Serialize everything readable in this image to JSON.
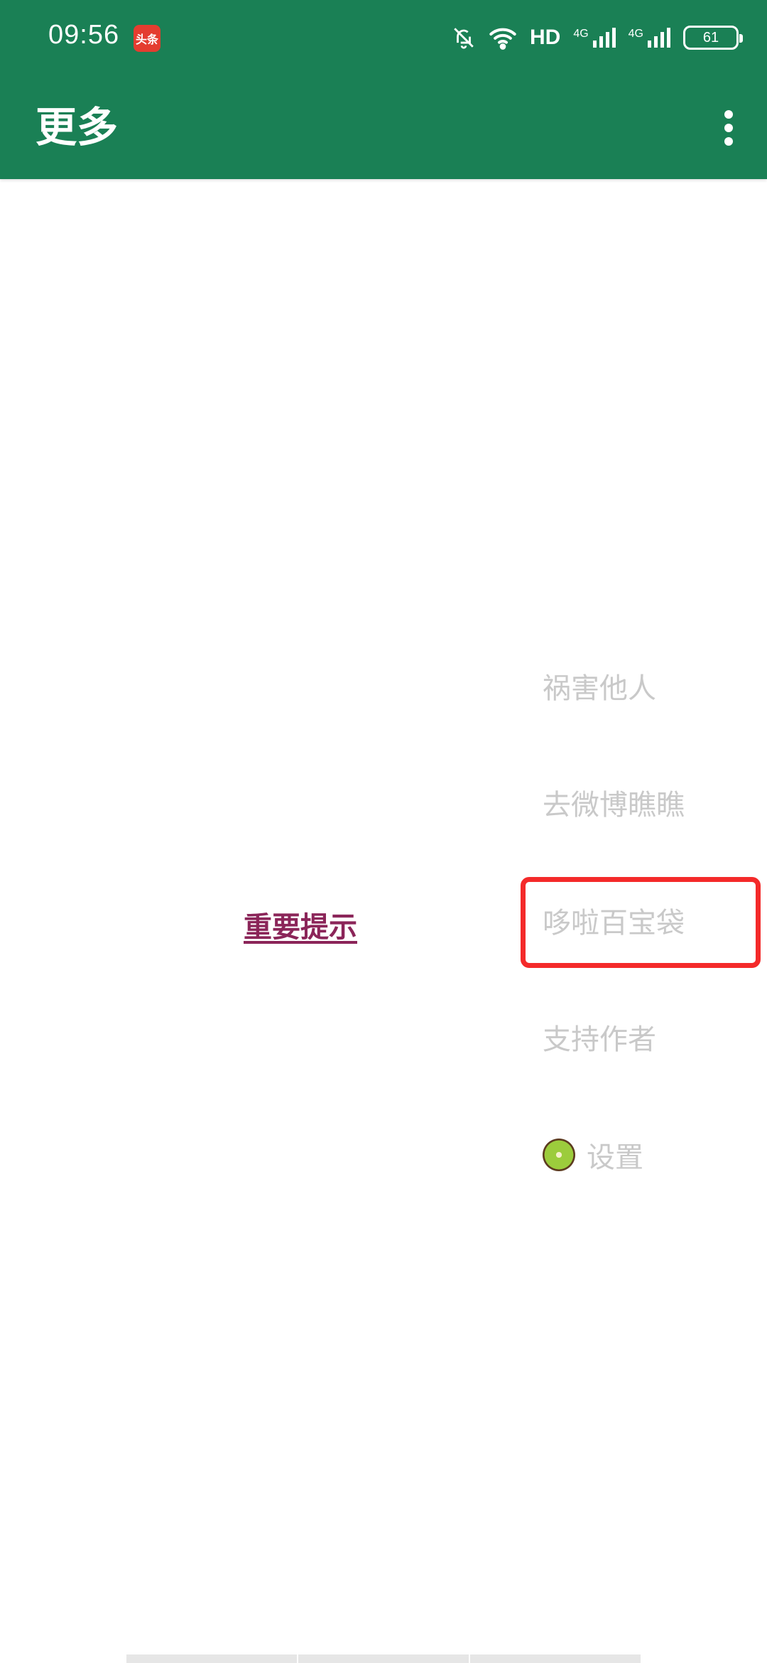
{
  "status_bar": {
    "time": "09:56",
    "app_badge": "头条",
    "hd_label": "HD",
    "network_1": "4G",
    "network_2": "4G",
    "battery": "61",
    "icons": [
      "notifications-off-icon",
      "wifi-icon",
      "hd-icon",
      "signal-icon",
      "signal-icon",
      "battery-icon"
    ]
  },
  "app_bar": {
    "title": "更多",
    "overflow_icon": "more-vert-icon"
  },
  "content": {
    "notice_link": "重要提示"
  },
  "menu": {
    "items": [
      {
        "label": "祸害他人"
      },
      {
        "label": "去微博瞧瞧"
      },
      {
        "label": "哆啦百宝袋"
      },
      {
        "label": "支持作者"
      },
      {
        "label": "设置",
        "icon": "kiwi-icon"
      }
    ],
    "highlighted": "哆啦百宝袋"
  },
  "colors": {
    "app_bar": "#1a8055",
    "link": "#8b2559",
    "menu_text": "#c9c9c9",
    "highlight": "#f42a2a"
  }
}
